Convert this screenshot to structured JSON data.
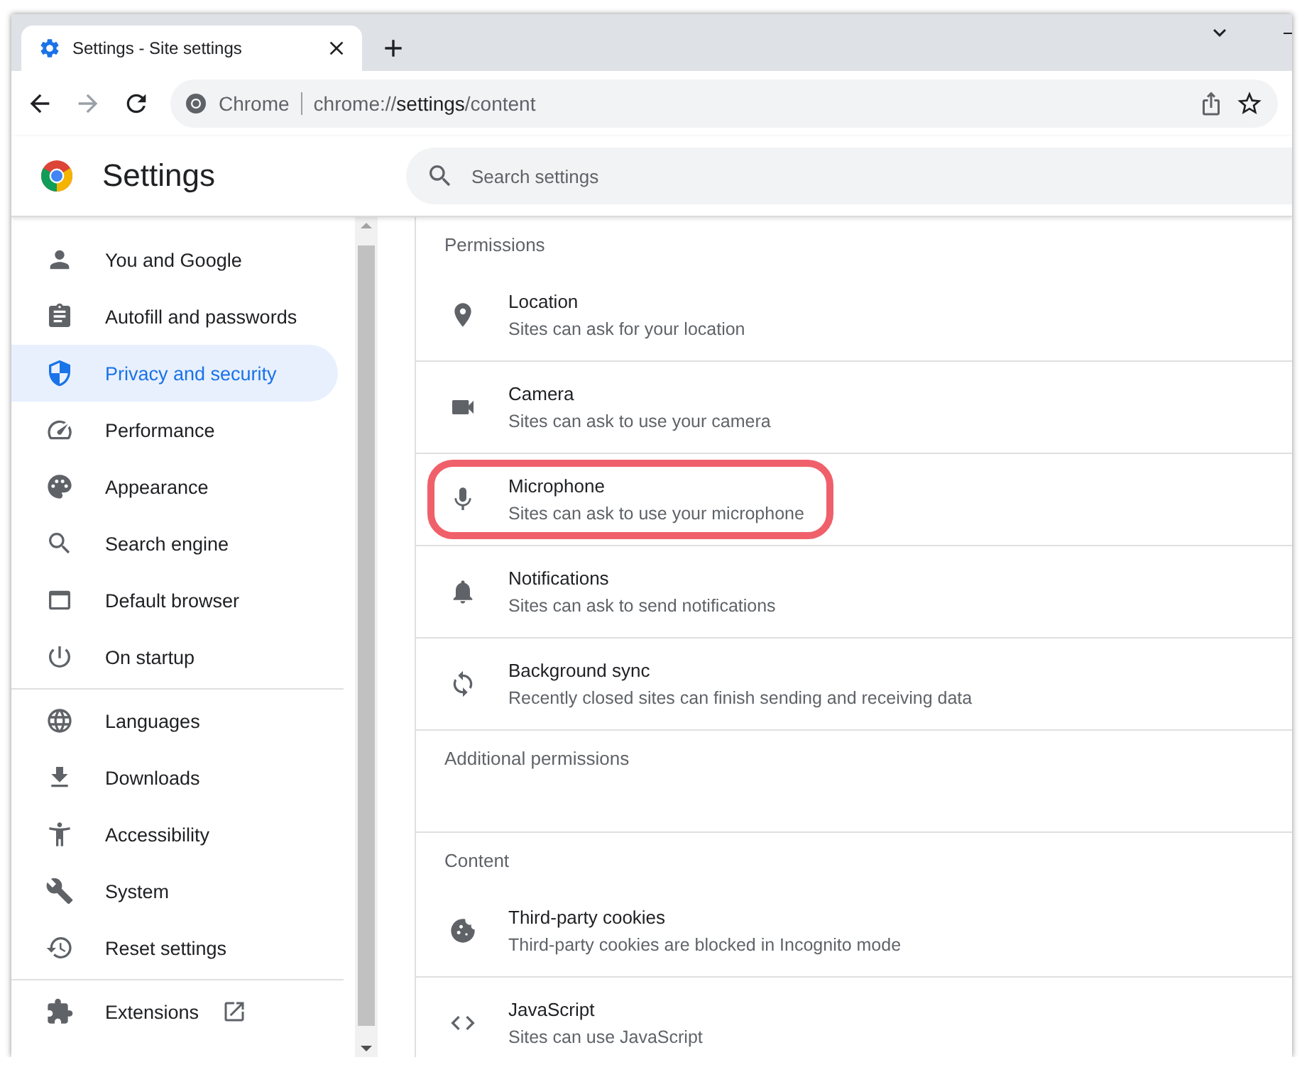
{
  "tab": {
    "title": "Settings - Site settings",
    "selected": true
  },
  "toolbar": {
    "site_label": "Chrome",
    "url_prefix": "chrome://",
    "url_host": "settings",
    "url_path": "/content"
  },
  "header": {
    "title": "Settings",
    "search": {
      "placeholder": "Search settings"
    }
  },
  "sidebar": {
    "groups": [
      [
        {
          "label": "You and Google",
          "selected": false,
          "kind": "page"
        },
        {
          "label": "Autofill and passwords",
          "selected": false,
          "kind": "page"
        },
        {
          "label": "Privacy and security",
          "selected": true,
          "kind": "page"
        },
        {
          "label": "Performance",
          "selected": false,
          "kind": "page"
        },
        {
          "label": "Appearance",
          "selected": false,
          "kind": "page"
        },
        {
          "label": "Search engine",
          "selected": false,
          "kind": "page"
        },
        {
          "label": "Default browser",
          "selected": false,
          "kind": "page"
        },
        {
          "label": "On startup",
          "selected": false,
          "kind": "page"
        }
      ],
      [
        {
          "label": "Languages",
          "selected": false,
          "kind": "page"
        },
        {
          "label": "Downloads",
          "selected": false,
          "kind": "page"
        },
        {
          "label": "Accessibility",
          "selected": false,
          "kind": "page"
        },
        {
          "label": "System",
          "selected": false,
          "kind": "page"
        },
        {
          "label": "Reset settings",
          "selected": false,
          "kind": "page"
        }
      ],
      [
        {
          "label": "Extensions",
          "selected": false,
          "kind": "external"
        }
      ]
    ]
  },
  "sections": [
    {
      "heading": "Permissions",
      "rows": [
        {
          "title": "Location",
          "description": "Sites can ask for your location",
          "highlighted": false
        },
        {
          "title": "Camera",
          "description": "Sites can ask to use your camera",
          "highlighted": false
        },
        {
          "title": "Microphone",
          "description": "Sites can ask to use your microphone",
          "highlighted": true
        },
        {
          "title": "Notifications",
          "description": "Sites can ask to send notifications",
          "highlighted": false
        },
        {
          "title": "Background sync",
          "description": "Recently closed sites can finish sending and receiving data",
          "highlighted": false
        }
      ]
    },
    {
      "heading": "Additional permissions"
    },
    {
      "heading": "Content",
      "rows": [
        {
          "title": "Third-party cookies",
          "description": "Third-party cookies are blocked in Incognito mode",
          "highlighted": false
        },
        {
          "title": "JavaScript",
          "description": "Sites can use JavaScript",
          "highlighted": false
        }
      ]
    }
  ]
}
